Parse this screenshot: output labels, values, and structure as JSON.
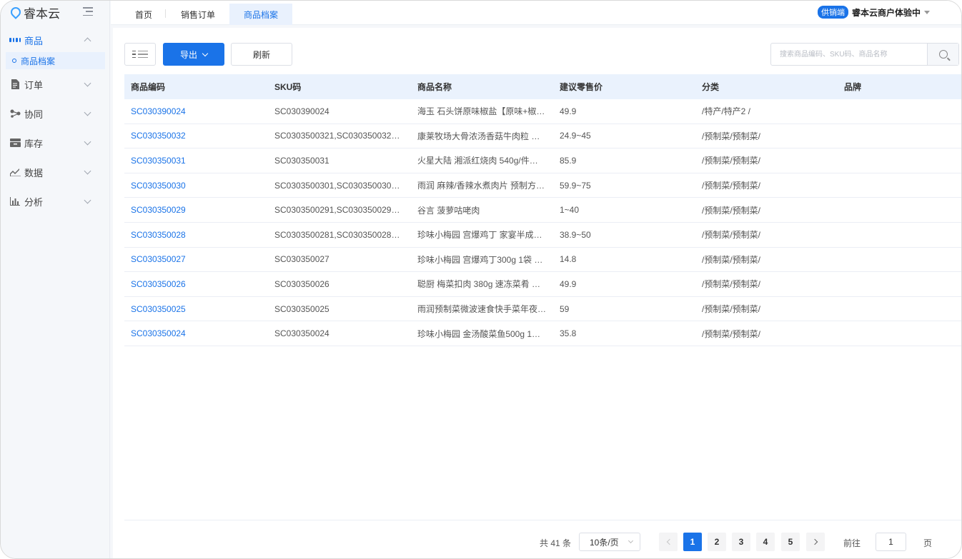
{
  "app": {
    "logo_text": "睿本云"
  },
  "sidebar": {
    "items": [
      {
        "label": "商品",
        "icon": "grid-icon",
        "open": true
      },
      {
        "label": "订单",
        "icon": "document-icon"
      },
      {
        "label": "协同",
        "icon": "share-icon"
      },
      {
        "label": "库存",
        "icon": "warehouse-icon"
      },
      {
        "label": "数据",
        "icon": "trend-chart-icon"
      },
      {
        "label": "分析",
        "icon": "bar-chart-icon"
      }
    ],
    "sub_items": [
      {
        "label": "商品档案",
        "active": true
      }
    ]
  },
  "tabs": [
    {
      "label": "首页"
    },
    {
      "label": "销售订单"
    },
    {
      "label": "商品档案",
      "active": true
    }
  ],
  "user": {
    "role_badge": "供销端",
    "company": "睿本云商户体验中"
  },
  "toolbar": {
    "export_label": "导出",
    "refresh_label": "刷新",
    "search_placeholder": "搜索商品编码、SKU码、商品名称",
    "search_value": ""
  },
  "table": {
    "headers": [
      "商品编码",
      "SKU码",
      "商品名称",
      "建议零售价",
      "分类",
      "品牌"
    ],
    "rows": [
      [
        "SC030390024",
        "SC030390024",
        "海玉 石头饼原味椒盐【原味+椒…",
        "49.9",
        "/特产/特产2 /",
        ""
      ],
      [
        "SC030350032",
        "SC0303500321,SC030350032…",
        "康莱牧场大骨浓汤香菇牛肉粒 …",
        "24.9~45",
        "/预制菜/预制菜/",
        ""
      ],
      [
        "SC030350031",
        "SC030350031",
        "火星大陆 湘派红烧肉 540g/件…",
        "85.9",
        "/预制菜/预制菜/",
        ""
      ],
      [
        "SC030350030",
        "SC0303500301,SC030350030…",
        "雨润 麻辣/香辣水煮肉片 预制方…",
        "59.9~75",
        "/预制菜/预制菜/",
        ""
      ],
      [
        "SC030350029",
        "SC0303500291,SC030350029…",
        "谷言 菠萝咕咾肉",
        "1~40",
        "/预制菜/预制菜/",
        ""
      ],
      [
        "SC030350028",
        "SC0303500281,SC030350028…",
        "珍味小梅园 宫爆鸡丁 家宴半成…",
        "38.9~50",
        "/预制菜/预制菜/",
        ""
      ],
      [
        "SC030350027",
        "SC030350027",
        "珍味小梅园 宫爆鸡丁300g 1袋 …",
        "14.8",
        "/预制菜/预制菜/",
        ""
      ],
      [
        "SC030350026",
        "SC030350026",
        "聪厨 梅菜扣肉 380g 速冻菜肴 …",
        "49.9",
        "/预制菜/预制菜/",
        ""
      ],
      [
        "SC030350025",
        "SC030350025",
        "雨润预制菜微波速食快手菜年夜…",
        "59",
        "/预制菜/预制菜/",
        ""
      ],
      [
        "SC030350024",
        "SC030350024",
        "珍味小梅园 金汤酸菜鱼500g 1…",
        "35.8",
        "/预制菜/预制菜/",
        ""
      ]
    ]
  },
  "pagination": {
    "total_label": "共 41 条",
    "page_size_label": "10条/页",
    "pages": [
      "1",
      "2",
      "3",
      "4",
      "5"
    ],
    "current_page": "1",
    "goto_label": "前往",
    "goto_value": "1",
    "page_suffix": "页"
  },
  "colors": {
    "accent": "#1a73e8",
    "header_bg": "#eaf2fd",
    "sidebar_bg": "#f5f7fa"
  }
}
